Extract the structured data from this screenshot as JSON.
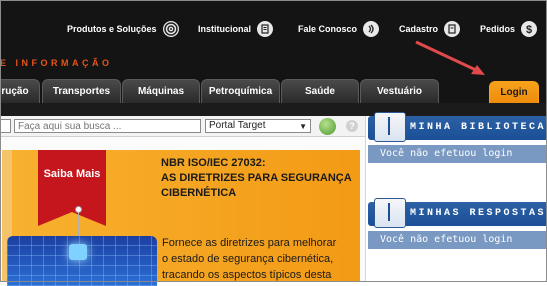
{
  "topnav": {
    "items": [
      {
        "label": "Produtos e Soluções",
        "icon": "target-icon"
      },
      {
        "label": "Institucional",
        "icon": "document-icon"
      },
      {
        "label": "Fale Conosco",
        "icon": "signal-icon"
      },
      {
        "label": "Cadastro",
        "icon": "form-icon"
      },
      {
        "label": "Pedidos",
        "icon": "dollar-icon"
      }
    ]
  },
  "brand": {
    "strip_text": "E INFORMAÇÃO"
  },
  "tabs": [
    {
      "label": "rução"
    },
    {
      "label": "Transportes"
    },
    {
      "label": "Máquinas"
    },
    {
      "label": "Petroquímica"
    },
    {
      "label": "Saúde"
    },
    {
      "label": "Vestuário"
    },
    {
      "label": "Login"
    }
  ],
  "search": {
    "placeholder": "Faça aqui sua busca ...",
    "scope_selected": "Portal Target",
    "help": "?"
  },
  "banner": {
    "ribbon": "Saiba Mais",
    "title_lines": [
      "NBR ISO/IEC 27032:",
      "AS DIRETRIZES PARA SEGURANÇA",
      "CIBERNÉTICA"
    ],
    "body_lines": [
      "Fornece as diretrizes para melhorar",
      "o estado de segurança cibernética,",
      "tracando os aspectos típicos desta"
    ]
  },
  "sidebar": {
    "biblioteca": {
      "title": "MINHA BIBLIOTECA",
      "status": "Você não efetuou login"
    },
    "respostas": {
      "title": "MINHAS RESPOSTAS",
      "status": "Você não efetuou login"
    }
  },
  "colors": {
    "accent_orange": "#ef8b0c",
    "brand_orange": "#e8541a",
    "panel_blue": "#1b4f96",
    "banner_orange": "#f39a16",
    "arrow_red": "#e04a4a"
  }
}
